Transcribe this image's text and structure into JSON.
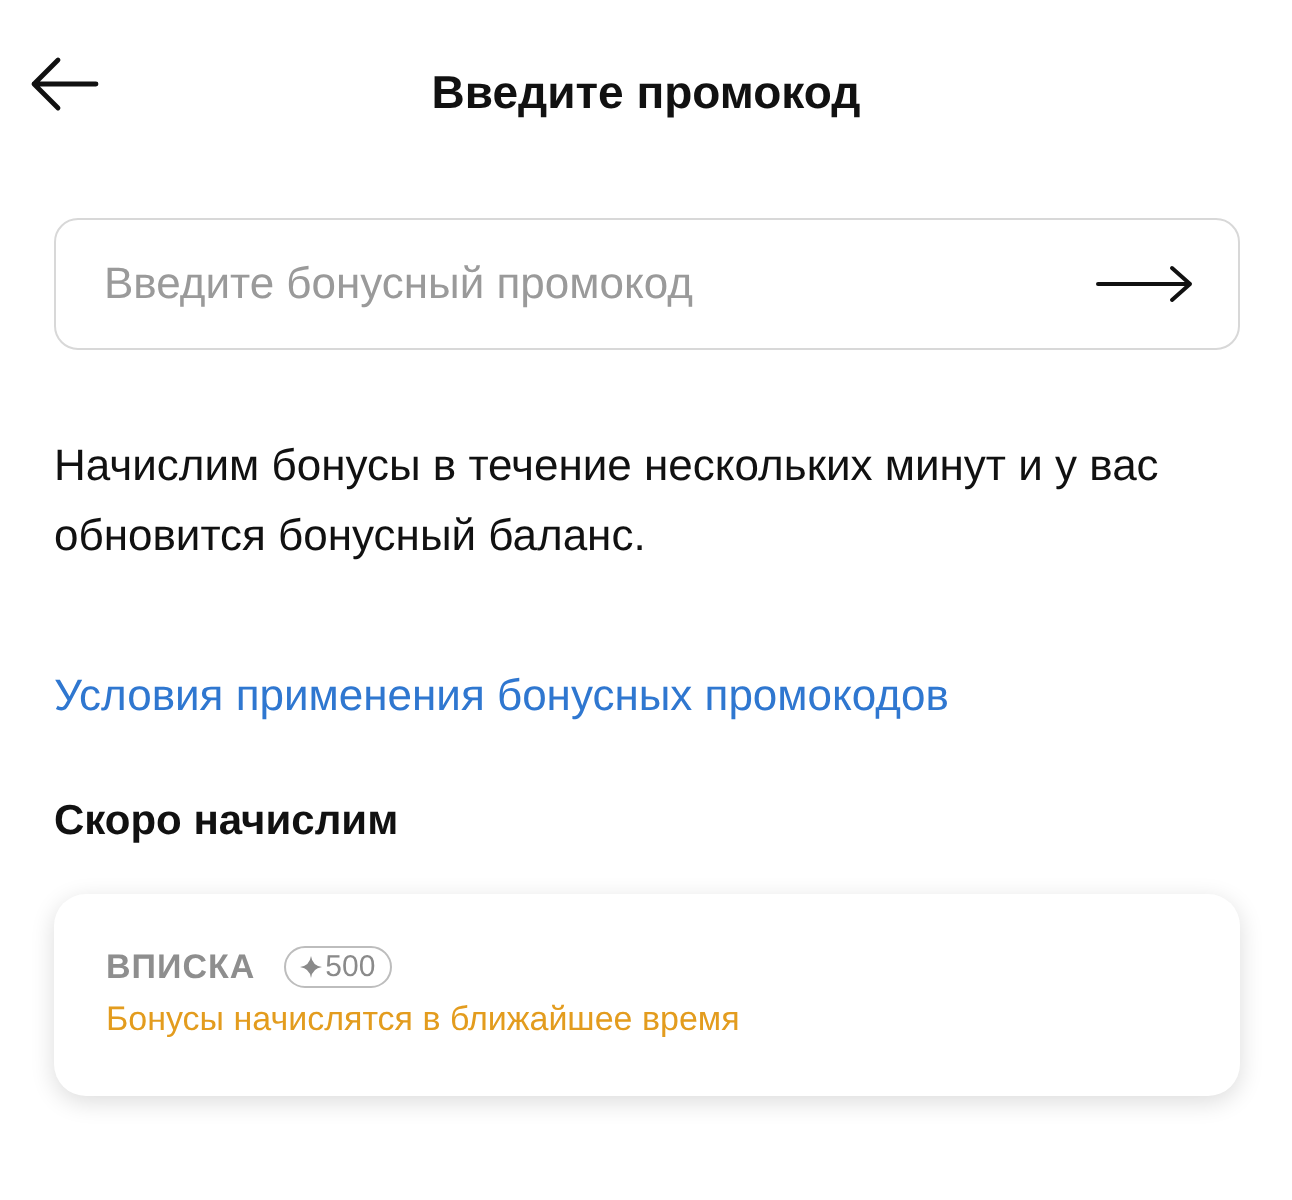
{
  "header": {
    "title": "Введите промокод"
  },
  "promo_field": {
    "placeholder": "Введите бонусный промокод"
  },
  "description": "Начислим бонусы в течение нескольких минут и у вас обновится бонусный баланс.",
  "terms_link": "Условия применения бонусных промокодов",
  "pending": {
    "title": "Скоро начислим",
    "items": [
      {
        "code": "ВПИСКА",
        "bonus": "500",
        "status": "Бонусы начислятся в ближайшее время"
      }
    ]
  }
}
